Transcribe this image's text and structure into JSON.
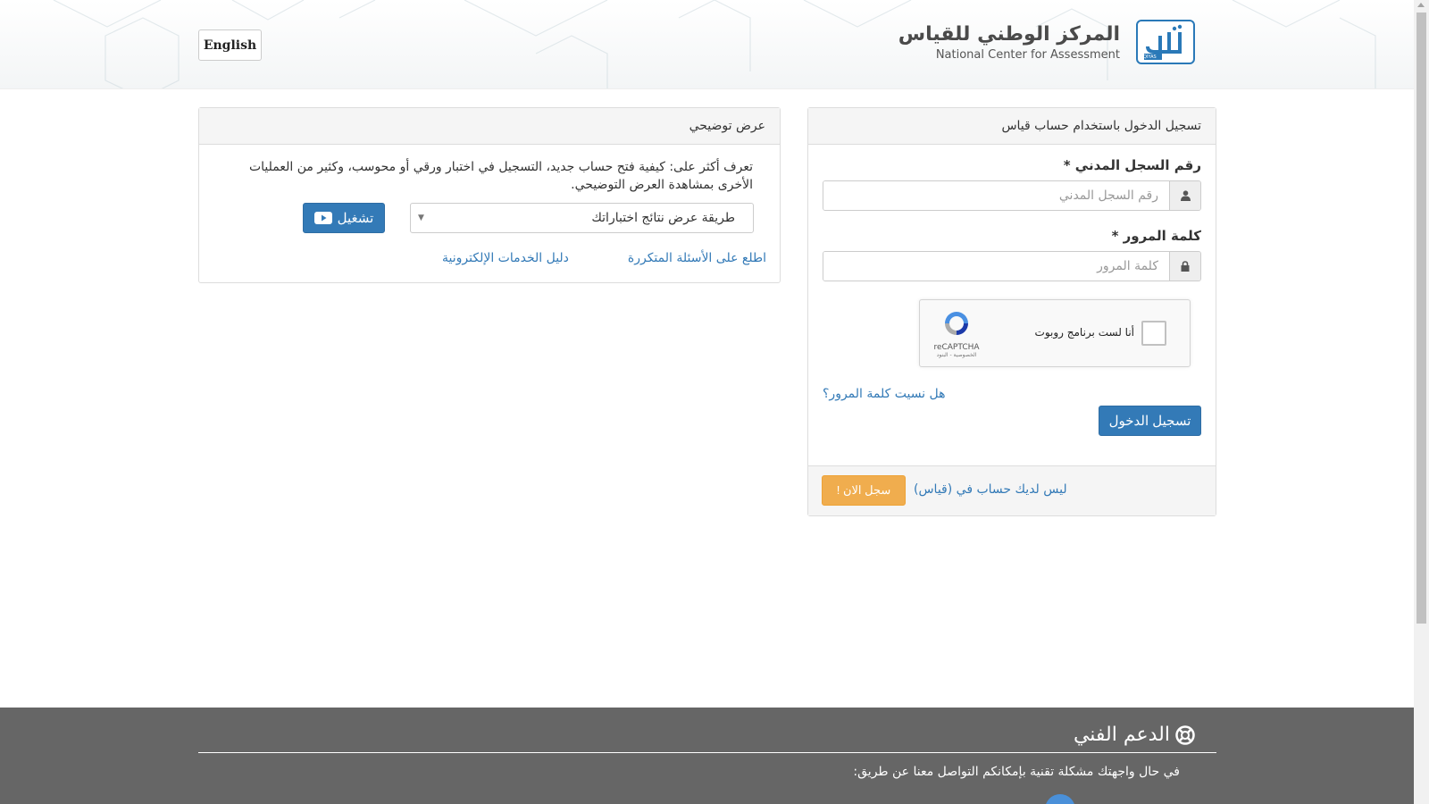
{
  "header": {
    "lang_button": "English",
    "brand_ar": "المركز الوطني للقياس",
    "brand_en": "National Center for Assessment",
    "logo_text": "QIYAS"
  },
  "login_panel": {
    "title": "تسجيل الدخول باستخدام حساب قياس",
    "id_label": "رقم السجل المدني *",
    "id_placeholder": "رقم السجل المدني",
    "id_value": "",
    "password_label": "كلمة المرور *",
    "password_placeholder": "كلمة المرور",
    "password_value": "",
    "captcha_label": "أنا لست برنامج روبوت",
    "captcha_brand": "reCAPTCHA",
    "captcha_terms": "الخصوصية - البنود",
    "forgot_link": "هل نسيت كلمة المرور؟",
    "submit_button": "تسجيل الدخول",
    "no_account_text": "ليس لديك حساب في (قياس)",
    "register_button": "سجل الان !"
  },
  "demo_panel": {
    "title": "عرض توضيحي",
    "description": "تعرف أكثر على: كيفية فتح حساب جديد، التسجيل في اختبار ورقي أو محوسب، وكثير من العمليات الأخرى بمشاهدة العرض التوضيحي.",
    "select_value": "طريقة عرض نتائج اختباراتك",
    "play_button": "تشغيل",
    "faq_link": "اطلع على الأسئلة المتكررة",
    "guide_link": "دليل الخدمات الإلكترونية"
  },
  "footer": {
    "support_title": "الدعم الفني",
    "support_text": "في حال واجهتك مشكلة تقنية بإمكانكم التواصل معنا عن طريق:"
  },
  "colors": {
    "primary": "#337ab7",
    "warning": "#f0ad4e",
    "footer_bg": "#666666"
  }
}
